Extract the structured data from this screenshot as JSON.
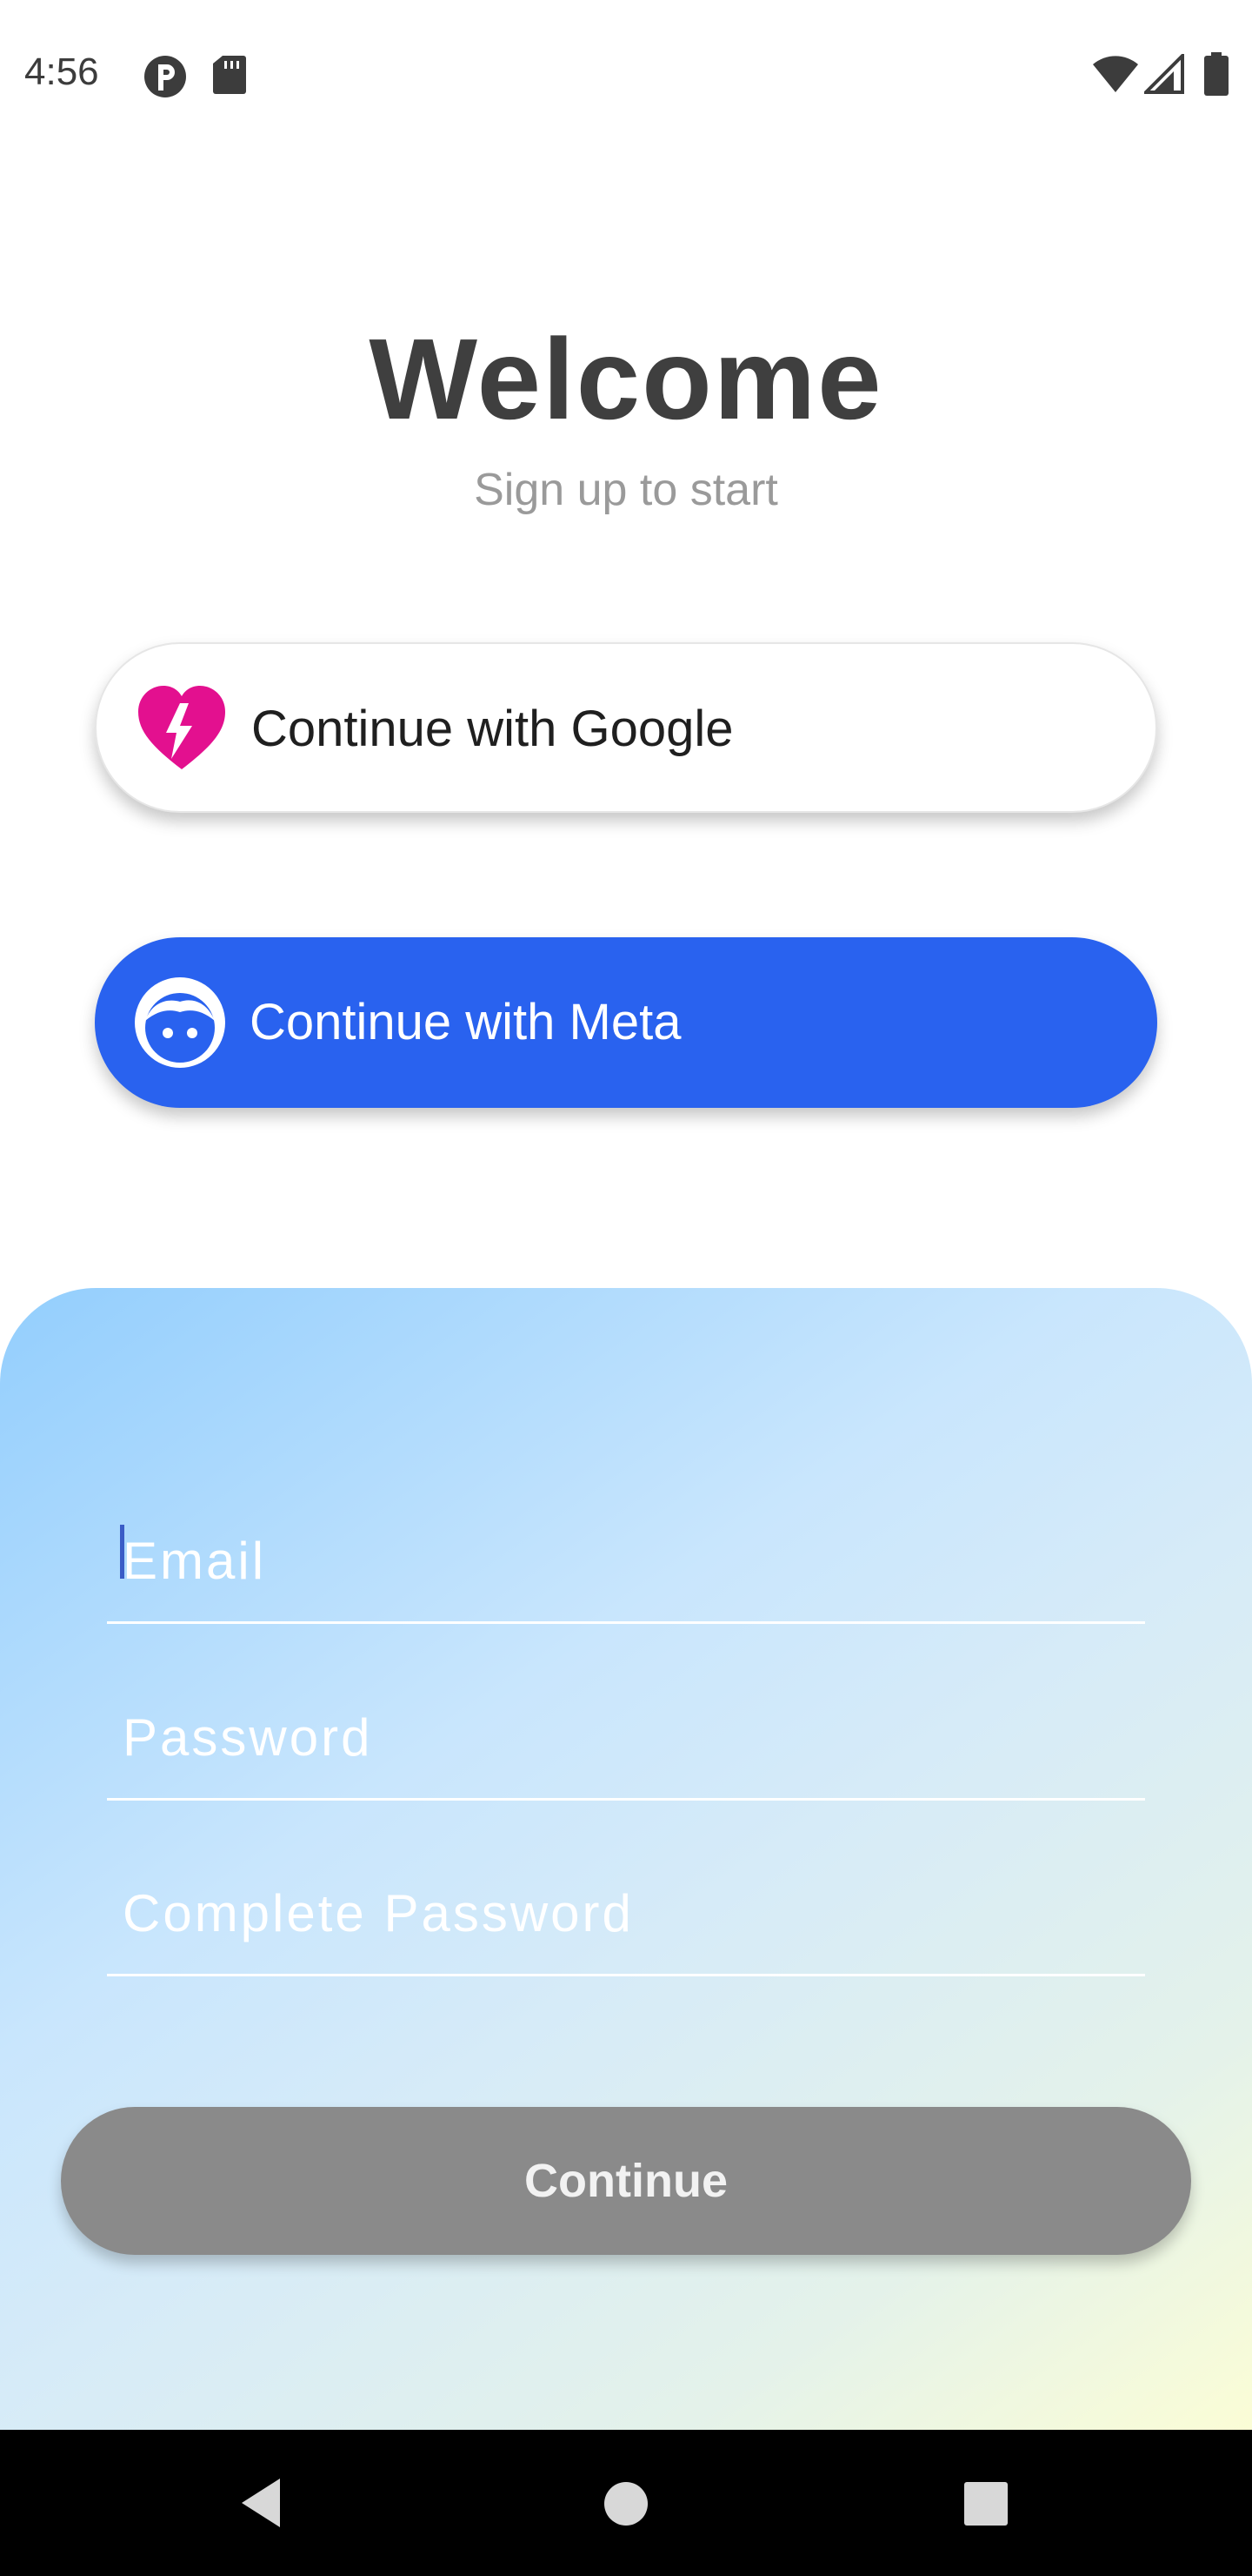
{
  "status_bar": {
    "time": "4:56",
    "left_icons": [
      "privacy-shield-icon",
      "sd-card-icon"
    ],
    "right_icons": [
      "wifi-icon",
      "cellular-signal-icon",
      "battery-icon"
    ]
  },
  "header": {
    "title": "Welcome",
    "subtitle": "Sign up to start"
  },
  "social_login": {
    "google": {
      "label": "Continue with Google",
      "icon": "broken-heart-icon",
      "icon_color": "#e3108f"
    },
    "meta": {
      "label": "Continue with Meta",
      "icon": "face-icon",
      "background": "#2962ef"
    }
  },
  "form": {
    "email": {
      "placeholder": "Email",
      "value": ""
    },
    "password": {
      "placeholder": "Password",
      "value": ""
    },
    "confirm_password": {
      "placeholder": "Complete Password",
      "value": ""
    },
    "submit_label": "Continue",
    "submit_color": "#8a8a8a"
  },
  "nav_bar": {
    "buttons": [
      "back-icon",
      "home-icon",
      "recents-icon"
    ]
  }
}
